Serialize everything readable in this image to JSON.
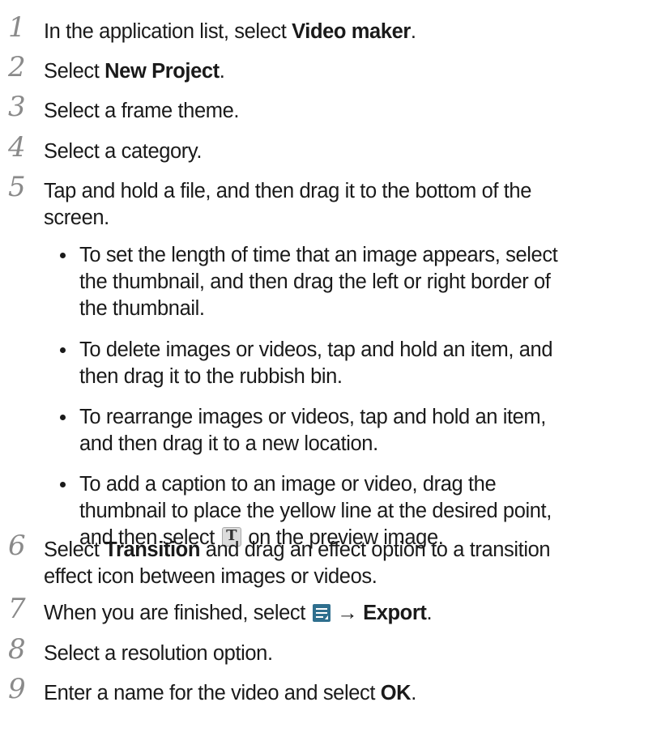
{
  "steps": [
    {
      "num": "1",
      "pre": "In the application list, select ",
      "bold": "Video maker",
      "post": "."
    },
    {
      "num": "2",
      "pre": "Select ",
      "bold": "New Project",
      "post": "."
    },
    {
      "num": "3",
      "pre": "Select a frame theme.",
      "bold": "",
      "post": ""
    },
    {
      "num": "4",
      "pre": "Select a category.",
      "bold": "",
      "post": ""
    },
    {
      "num": "5",
      "line1": "Tap and hold a file, and then drag it to the bottom of the",
      "line2": "screen."
    },
    {
      "num": "6",
      "line1_bold": "Transition",
      "line1_post": " and drag an effect option to a transition",
      "line1_pre": "Select ",
      "line2": "effect icon between images or videos."
    },
    {
      "num": "7",
      "pre": "When you are finished, select ",
      "arrow": " → ",
      "bold": "Export",
      "post": "."
    },
    {
      "num": "8",
      "pre": "Select a resolution option.",
      "bold": "",
      "post": ""
    },
    {
      "num": "9",
      "pre": "Enter a name for the video and select ",
      "bold": "OK",
      "post": "."
    }
  ],
  "bullets": [
    {
      "lines": [
        "To set the length of time that an image appears, select",
        "the thumbnail, and then drag the left or right border of",
        "the thumbnail."
      ]
    },
    {
      "lines": [
        "To delete images or videos, tap and hold an item, and",
        "then drag it to the rubbish bin."
      ]
    },
    {
      "lines": [
        "To rearrange images or videos, tap and hold an item,",
        "and then drag it to a new location."
      ]
    },
    {
      "lines": [
        "To add a caption to an image or video, drag the",
        "thumbnail to place the yellow line at the desired point,",
        "and then select "
      ],
      "icon_letter": "T",
      "tail": " on the preview image."
    }
  ],
  "icons": {
    "caption": "text-caption-icon",
    "menu": "menu-icon"
  },
  "colors": {
    "step_number": "#8a8a8a",
    "menu_icon": "#2f6f8e",
    "text": "#1a1a1a"
  }
}
